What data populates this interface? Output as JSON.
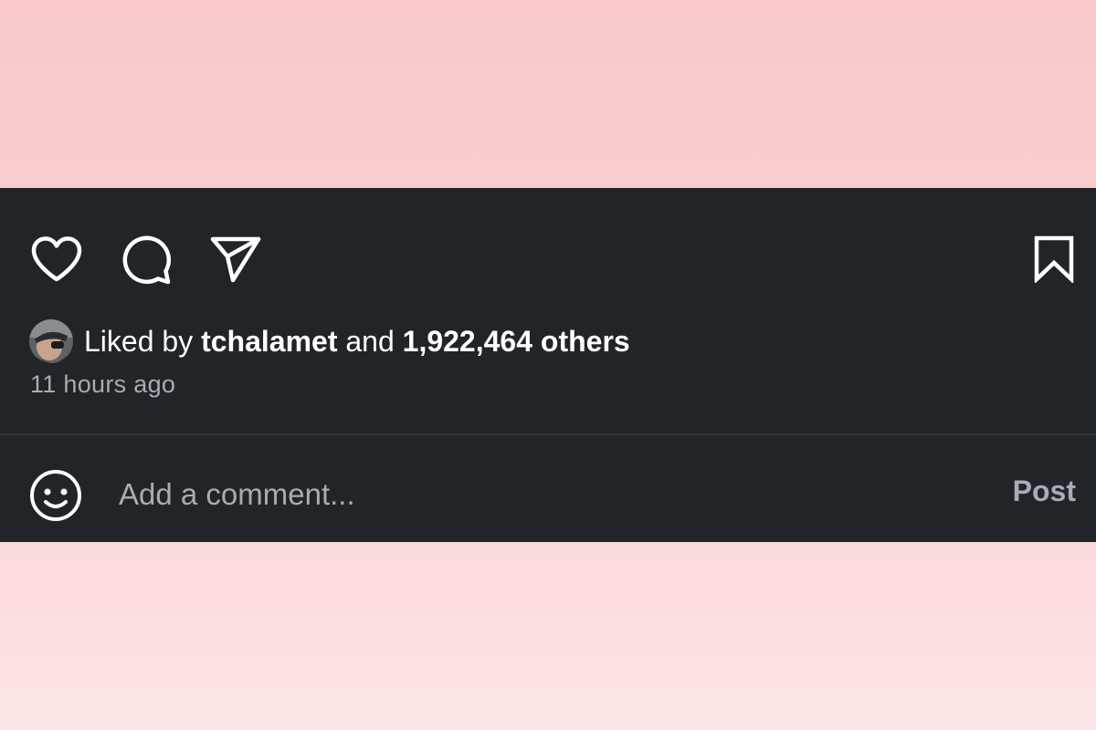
{
  "colors": {
    "panel_background": "#212429",
    "primary_text": "#ffffff",
    "secondary_text": "#a8acb3",
    "divider": "#34383e"
  },
  "actions": {
    "icons": [
      "heart-icon",
      "comment-icon",
      "share-icon",
      "bookmark-icon"
    ]
  },
  "likes": {
    "prefix": "Liked by",
    "user": "tchalamet",
    "connector": "and",
    "count_text": "1,922,464 others"
  },
  "timestamp": "11 hours ago",
  "comment": {
    "placeholder": "Add a comment...",
    "post_label": "Post",
    "emoji_icon": "smiley-icon"
  }
}
